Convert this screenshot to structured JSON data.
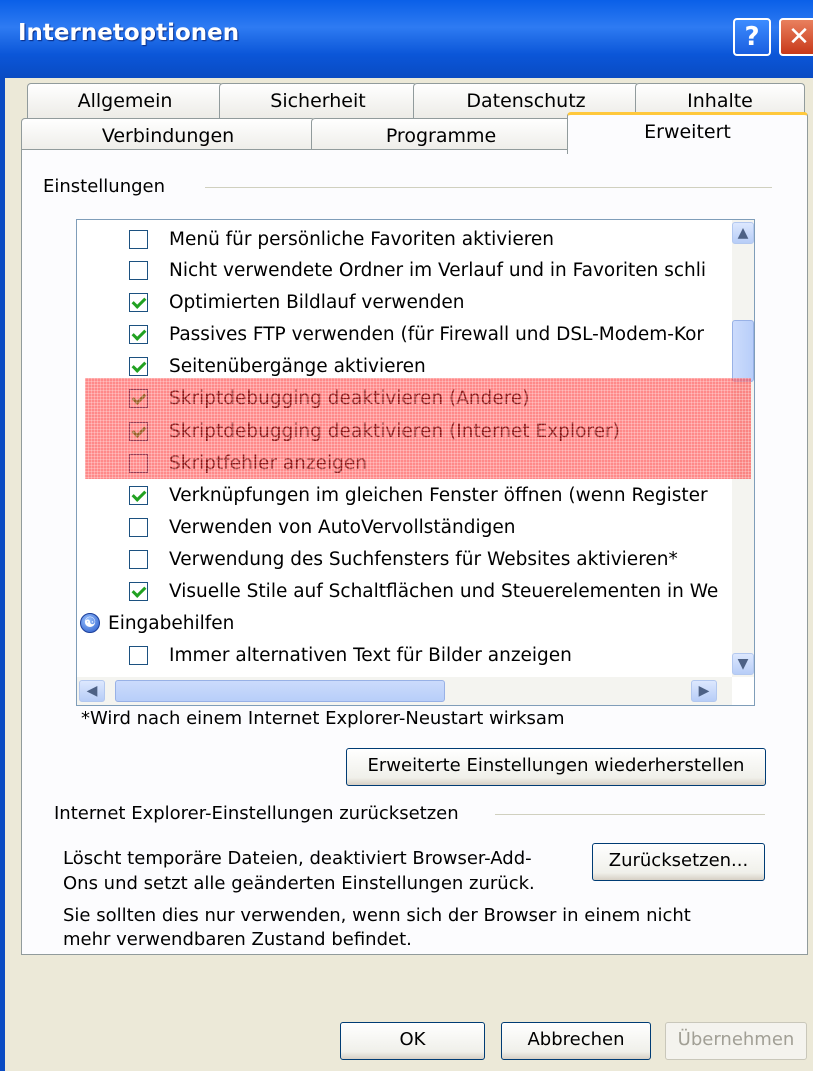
{
  "window": {
    "title": "Internetoptionen",
    "help_glyph": "?",
    "close_glyph": "✕"
  },
  "tabs_row1": [
    "Allgemein",
    "Sicherheit",
    "Datenschutz",
    "Inhalte"
  ],
  "tabs_row2": [
    "Verbindungen",
    "Programme",
    "Erweitert"
  ],
  "settings": {
    "group_label": "Einstellungen",
    "items": [
      {
        "label": "Menü für persönliche Favoriten aktivieren",
        "checked": false
      },
      {
        "label": "Nicht verwendete Ordner im Verlauf und in Favoriten schli",
        "checked": false
      },
      {
        "label": "Optimierten Bildlauf verwenden",
        "checked": true
      },
      {
        "label": "Passives FTP verwenden (für Firewall und DSL-Modem-Kor",
        "checked": true
      },
      {
        "label": "Seitenübergänge aktivieren",
        "checked": true
      },
      {
        "label": "Skriptdebugging deaktivieren (Andere)",
        "checked": true
      },
      {
        "label": "Skriptdebugging deaktivieren (Internet Explorer)",
        "checked": true
      },
      {
        "label": "Skriptfehler anzeigen",
        "checked": false
      },
      {
        "label": "Verknüpfungen im gleichen Fenster öffnen (wenn Register",
        "checked": true
      },
      {
        "label": "Verwenden von AutoVervollständigen",
        "checked": false
      },
      {
        "label": "Verwendung des Suchfensters für Websites aktivieren*",
        "checked": false
      },
      {
        "label": "Visuelle Stile auf Schaltflächen und Steuerelementen in We",
        "checked": true
      },
      {
        "label": "Eingabehilfen",
        "group": true
      },
      {
        "label": "Immer alternativen Text für Bilder anzeigen",
        "checked": false
      }
    ],
    "restart_note": "*Wird nach einem Internet Explorer-Neustart wirksam",
    "restore_button": "Erweiterte Einstellungen wiederherstellen"
  },
  "reset": {
    "group_label": "Internet Explorer-Einstellungen zurücksetzen",
    "description_line1": "Löscht temporäre Dateien, deaktiviert Browser-Add-",
    "description_line2": "Ons und setzt alle geänderten Einstellungen zurück.",
    "reset_button": "Zurücksetzen...",
    "warning_line1": "Sie sollten dies nur verwenden, wenn sich der Browser in einem nicht",
    "warning_line2": "mehr verwendbaren Zustand befindet."
  },
  "footer": {
    "ok": "OK",
    "cancel": "Abbrechen",
    "apply": "Übernehmen"
  },
  "highlight_color": "#FF2828"
}
